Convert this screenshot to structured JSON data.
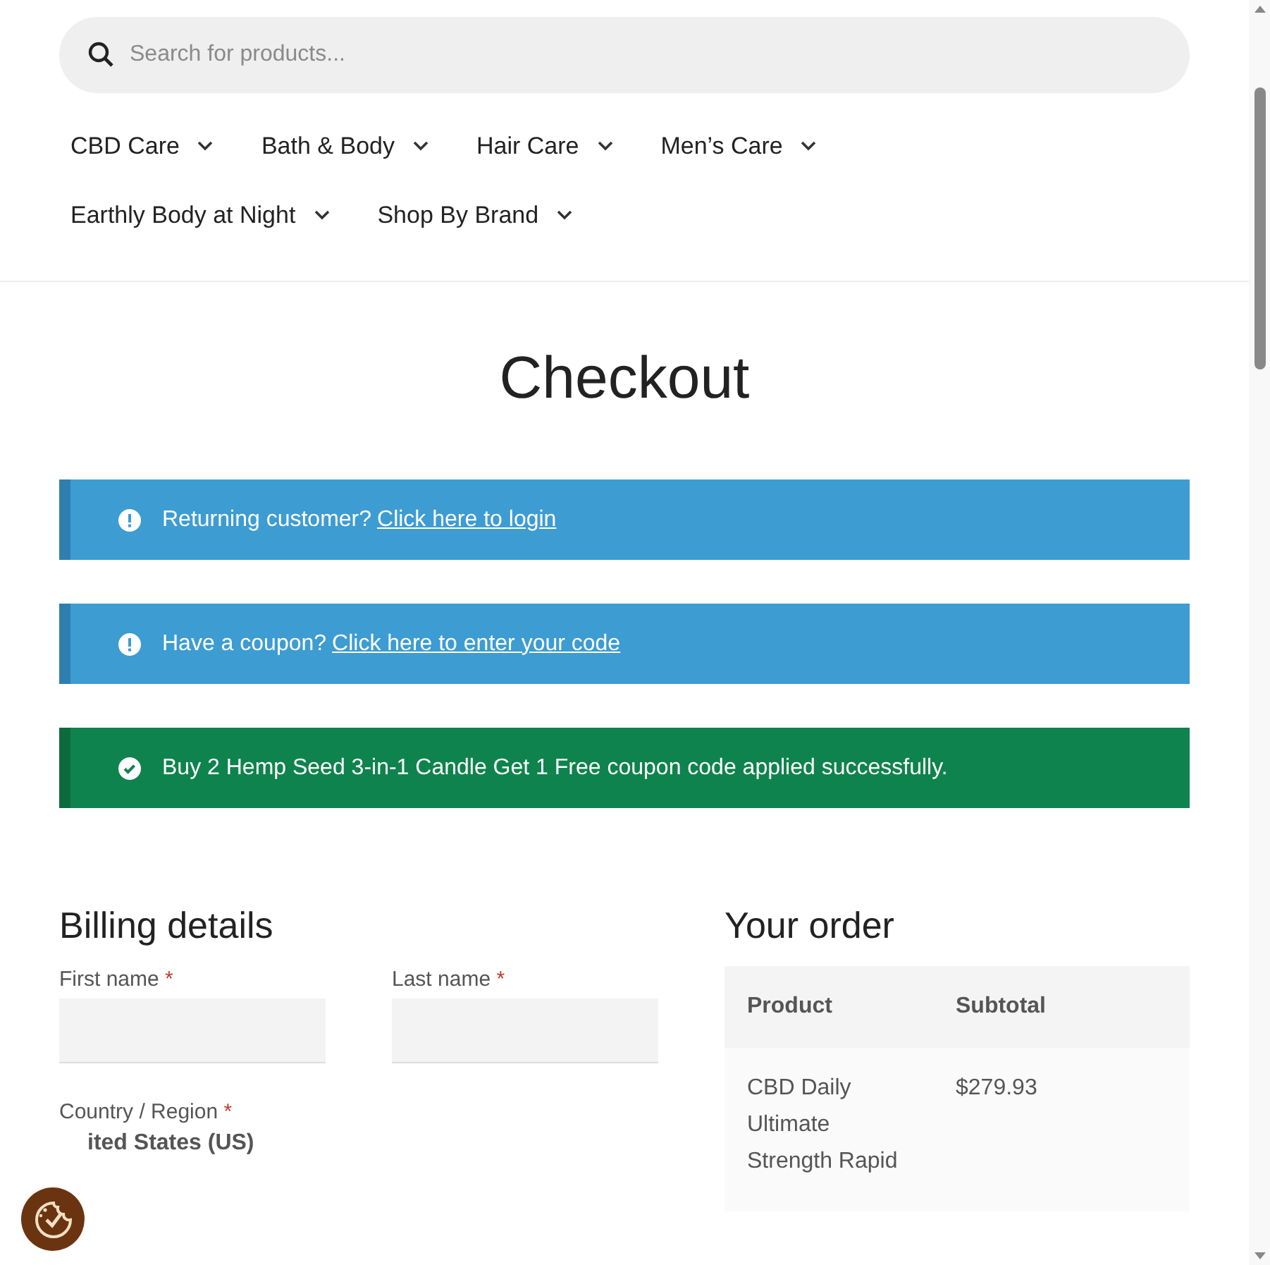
{
  "search": {
    "placeholder": "Search for products..."
  },
  "nav": [
    {
      "label": "CBD Care"
    },
    {
      "label": "Bath & Body"
    },
    {
      "label": "Hair Care"
    },
    {
      "label": "Men’s Care"
    },
    {
      "label": "Earthly Body at Night"
    },
    {
      "label": "Shop By Brand"
    }
  ],
  "page_title": "Checkout",
  "notices": [
    {
      "kind": "info",
      "text": "Returning customer?",
      "link": "Click here to login"
    },
    {
      "kind": "info",
      "text": "Have a coupon?",
      "link": "Click here to enter your code"
    },
    {
      "kind": "success",
      "text": "Buy 2 Hemp Seed 3-in-1 Candle Get 1 Free coupon code applied successfully."
    }
  ],
  "billing": {
    "heading": "Billing details",
    "fields": [
      {
        "label": "First name",
        "required": "*"
      },
      {
        "label": "Last name",
        "required": "*"
      }
    ],
    "country": {
      "label": "Country / Region",
      "required": "*",
      "value": "ited States (US)"
    }
  },
  "order": {
    "heading": "Your order",
    "columns": [
      "Product",
      "Subtotal"
    ],
    "rows": [
      {
        "product": "CBD Daily Ultimate Strength Rapid",
        "subtotal": "$279.93"
      }
    ]
  }
}
